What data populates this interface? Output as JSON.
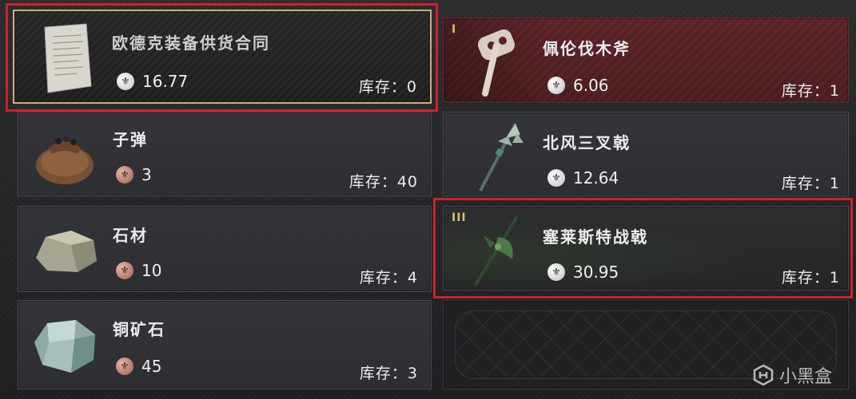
{
  "left_items": [
    {
      "name": "欧德克装备供货合同",
      "price": "16.77",
      "coin": "silver",
      "stock": "库存：0"
    },
    {
      "name": "子弹",
      "price": "3",
      "coin": "copper",
      "stock": "库存：40"
    },
    {
      "name": "石材",
      "price": "10",
      "coin": "copper",
      "stock": "库存：4"
    },
    {
      "name": "铜矿石",
      "price": "45",
      "coin": "copper",
      "stock": "库存：3"
    }
  ],
  "right_items": [
    {
      "name": "佩伦伐木斧",
      "price": "6.06",
      "coin": "silver",
      "stock": "库存：1",
      "tier": "I"
    },
    {
      "name": "北风三叉戟",
      "price": "12.64",
      "coin": "silver",
      "stock": "库存：1",
      "tier": ""
    },
    {
      "name": "塞莱斯特战戟",
      "price": "30.95",
      "coin": "silver",
      "stock": "库存：1",
      "tier": "III"
    }
  ],
  "coin_glyph": "⚜",
  "watermark": "小黑盒",
  "colors": {
    "highlight": "#d0202a",
    "gold_border": "#c9b47a",
    "red_card": "#5b2326",
    "tier": "#d8c26a"
  }
}
